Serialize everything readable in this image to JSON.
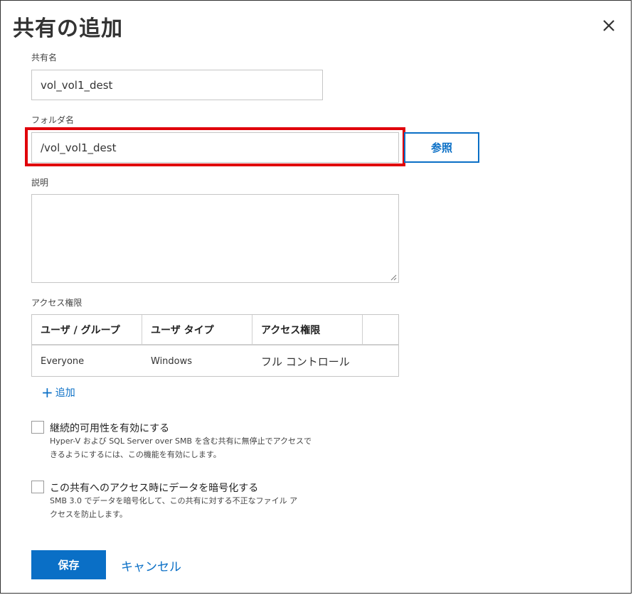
{
  "dialog": {
    "title": "共有の追加",
    "close_icon": "close-icon"
  },
  "form": {
    "share_name": {
      "label": "共有名",
      "value": "vol_vol1_dest"
    },
    "folder_name": {
      "label": "フォルダ名",
      "value": "/vol_vol1_dest",
      "browse_label": "参照",
      "highlight_color": "#e0000a"
    },
    "description": {
      "label": "説明",
      "value": ""
    },
    "access": {
      "label": "アクセス権限",
      "columns": [
        "ユーザ / グループ",
        "ユーザ タイプ",
        "アクセス権限",
        ""
      ],
      "rows": [
        [
          "Everyone",
          "Windows",
          "フル コントロール",
          ""
        ]
      ],
      "add_label": "追加"
    },
    "continuous_availability": {
      "label": "継続的可用性を有効にする",
      "checked": false,
      "description_line1": "Hyper-V および SQL Server over SMB を含む共有に無停止でアクセスで",
      "description_line2": "きるようにするには、この機能を有効にします。"
    },
    "encryption": {
      "label": "この共有へのアクセス時にデータを暗号化する",
      "checked": false,
      "description_line1": "SMB 3.0 でデータを暗号化して、この共有に対する不正なファイル ア",
      "description_line2": "クセスを防止します。"
    }
  },
  "footer": {
    "save_label": "保存",
    "cancel_label": "キャンセル"
  },
  "colors": {
    "accent": "#0a6fc6",
    "border": "#c6c6c6"
  }
}
